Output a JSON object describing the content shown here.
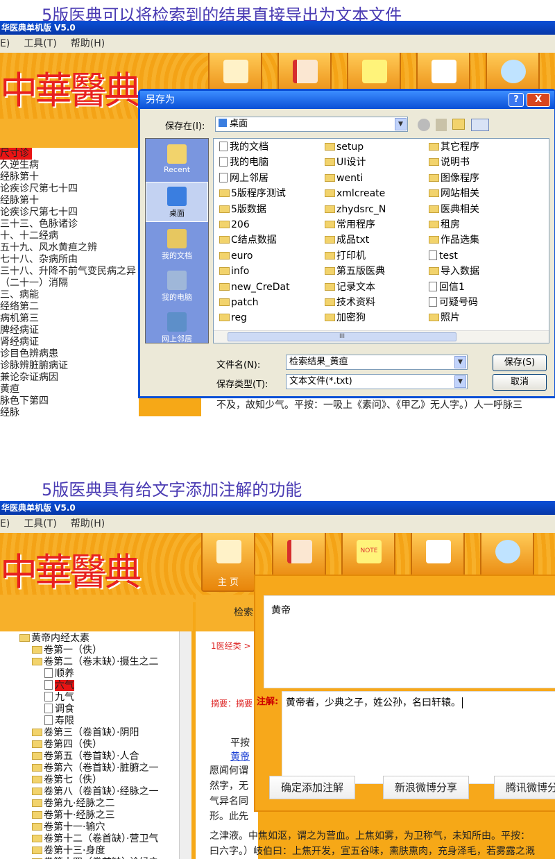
{
  "captions": {
    "top": "5版医典可以将检索到的结果直接导出为文本文件",
    "bottom": "5版医典具有给文字添加注解的功能"
  },
  "shot1": {
    "title": "华医典单机版 V5.0",
    "menu": [
      "E)",
      "工具(T)",
      "帮助(H)"
    ],
    "left_rows": [
      "尺寸诊",
      "久逆生病",
      "经脉第十",
      "论疾诊尺第七十四",
      "经脉第十",
      "论疾诊尺第七十四",
      "三十三、色脉诸诊",
      "十、十二经病",
      "五十九、风水黄疸之辨",
      "七十八、杂病所由",
      "三十八、升降不前气变民病之异",
      "（二十一）消隔",
      "三、病能",
      "经络第二",
      "病机第三",
      "脾经病证",
      "肾经病证",
      "诊目色辨病患",
      "诊脉辨脏腑病证",
      "兼论杂证病因",
      "黄疸",
      "脉色下第四",
      "经脉"
    ],
    "bottom_text": "不及，故知少气。平按：一吸上《素问》、《甲乙》无人字。）人一呼脉三",
    "dialog": {
      "title": "另存为",
      "save_in_label": "保存在(I):",
      "save_in_value": "桌面",
      "places": [
        "Recent",
        "桌面",
        "我的文档",
        "我的电脑",
        "网上邻居"
      ],
      "col1": [
        "我的文档",
        "我的电脑",
        "网上邻居",
        "5版程序测试",
        "5版数据",
        "206",
        "C结点数据",
        "euro",
        "info",
        "new_CreDat",
        "patch",
        "reg"
      ],
      "col2": [
        "setup",
        "UI设计",
        "wenti",
        "xmlcreate",
        "zhydsrc_N",
        "常用程序",
        "成品txt",
        "打印机",
        "第五版医典",
        "记录文本",
        "技术资料",
        "加密狗"
      ],
      "col3": [
        "其它程序",
        "说明书",
        "图像程序",
        "网站相关",
        "医典相关",
        "租房",
        "作品选集",
        "test",
        "导入数据",
        "回信1",
        "可疑号码",
        "照片"
      ],
      "scroll_mark": "III",
      "filename_label": "文件名(N):",
      "filename_value": "检索结果_黄疸",
      "filetype_label": "保存类型(T):",
      "filetype_value": "文本文件(*.txt)",
      "save_button": "保存(S)",
      "cancel_button": "取消",
      "help_button": "?",
      "close_button": "X"
    }
  },
  "shot2": {
    "title": "华医典单机版 V5.0",
    "menu": [
      "E)",
      "工具(T)",
      "帮助(H)"
    ],
    "home_label": "主 页",
    "note_label": "NOTE",
    "tree": [
      "黄帝内经太素",
      "卷第一（佚）",
      "卷第二（卷末缺）·摄生之二",
      "顺养",
      "六气",
      "九气",
      "调食",
      "寿限",
      "卷第三（卷首缺）·阴阳",
      "卷第四（佚）",
      "卷第五（卷首缺）·人合",
      "卷第六（卷首缺）·脏腑之一",
      "卷第七（佚）",
      "卷第八（卷首缺）·经脉之一",
      "卷第九·经脉之二",
      "卷第十·经脉之三",
      "卷第十一·输穴",
      "卷第十二（卷首缺）·营卫气",
      "卷第十三·身度",
      "卷第十四（卷首缺）·诊候之"
    ],
    "search_tab": "检索",
    "breadcrumb": "1医经类 >",
    "summary_label": "摘要：摘要",
    "content_lines": [
      "平按",
      "黄帝",
      "愿闻何谓",
      "然字，无",
      "气异名同",
      "形。此先",
      "之津液。中焦如沤，谓之为营血。上焦如雾，为卫称气，未知所由。平按：",
      "曰六字。）岐伯曰：上焦开发，宣五谷味，熏肤熏肉，充身泽毛，若雾露之溉"
    ],
    "annotation": {
      "title_text": "黄帝",
      "note_label": "注解:",
      "note_text": "黄帝者，少典之子，姓公孙，名曰轩辕。",
      "confirm_button": "确定添加注解",
      "sina_button": "新浪微博分享",
      "tencent_button": "腾讯微博分享"
    }
  }
}
